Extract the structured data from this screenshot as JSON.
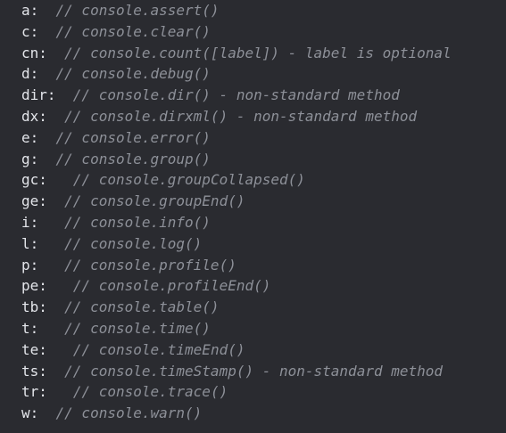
{
  "lines": [
    {
      "key": "a:",
      "gap": "  ",
      "comment": "// console.assert()"
    },
    {
      "key": "c:",
      "gap": "  ",
      "comment": "// console.clear()"
    },
    {
      "key": "cn:",
      "gap": "  ",
      "comment": "// console.count([label]) - label is optional"
    },
    {
      "key": "d:",
      "gap": "  ",
      "comment": "// console.debug()"
    },
    {
      "key": "dir:",
      "gap": "  ",
      "comment": "// console.dir() - non-standard method"
    },
    {
      "key": "dx:",
      "gap": "  ",
      "comment": "// console.dirxml() - non-standard method"
    },
    {
      "key": "e:",
      "gap": "  ",
      "comment": "// console.error()"
    },
    {
      "key": "g:",
      "gap": "  ",
      "comment": "// console.group()"
    },
    {
      "key": "gc:",
      "gap": "   ",
      "comment": "// console.groupCollapsed()"
    },
    {
      "key": "ge:",
      "gap": "  ",
      "comment": "// console.groupEnd()"
    },
    {
      "key": "i:",
      "gap": "   ",
      "comment": "// console.info()"
    },
    {
      "key": "l:",
      "gap": "   ",
      "comment": "// console.log()"
    },
    {
      "key": "p:",
      "gap": "   ",
      "comment": "// console.profile()"
    },
    {
      "key": "pe:",
      "gap": "   ",
      "comment": "// console.profileEnd()"
    },
    {
      "key": "tb:",
      "gap": "  ",
      "comment": "// console.table()"
    },
    {
      "key": "t:",
      "gap": "   ",
      "comment": "// console.time()"
    },
    {
      "key": "te:",
      "gap": "   ",
      "comment": "// console.timeEnd()"
    },
    {
      "key": "ts:",
      "gap": "  ",
      "comment": "// console.timeStamp() - non-standard method"
    },
    {
      "key": "tr:",
      "gap": "   ",
      "comment": "// console.trace()"
    },
    {
      "key": "w:",
      "gap": "  ",
      "comment": "// console.warn()"
    }
  ]
}
